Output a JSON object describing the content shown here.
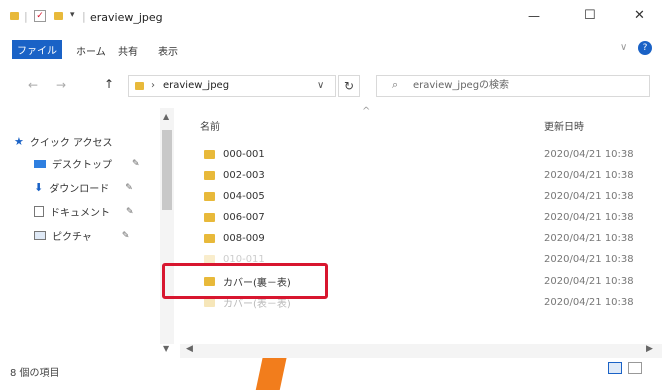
{
  "title_bar": {
    "title": "eraview_jpeg",
    "qat_sep": "|",
    "qat_dropdown": "▾"
  },
  "window_controls": {
    "minimize": "—",
    "maximize": "☐",
    "close": "✕"
  },
  "ribbon": {
    "file": "ファイル",
    "tabs": [
      "ホーム",
      "共有",
      "表示"
    ],
    "expand": "∨",
    "help": "?"
  },
  "address_bar": {
    "back": "←",
    "forward": "→",
    "up": "↑",
    "path_sep": "›",
    "path": "eraview_jpeg",
    "dropdown": "∨",
    "refresh": "↻"
  },
  "search": {
    "placeholder": "eraview_jpegの検索"
  },
  "sidebar": {
    "quick_access": "クイック アクセス",
    "items": [
      "デスクトップ",
      "ダウンロード",
      "ドキュメント",
      "ピクチャ"
    ]
  },
  "columns": {
    "name": "名前",
    "date": "更新日時",
    "sort_indicator": "^"
  },
  "files": [
    {
      "name": "000-001",
      "date": "2020/04/21 10:38"
    },
    {
      "name": "002-003",
      "date": "2020/04/21 10:38"
    },
    {
      "name": "004-005",
      "date": "2020/04/21 10:38"
    },
    {
      "name": "006-007",
      "date": "2020/04/21 10:38"
    },
    {
      "name": "008-009",
      "date": "2020/04/21 10:38"
    },
    {
      "name": "010-011",
      "date": "2020/04/21 10:38"
    },
    {
      "name": "カバー(裏－表)",
      "date": "2020/04/21 10:38"
    },
    {
      "name": "カバー(表－表)",
      "date": "2020/04/21 10:38"
    }
  ],
  "status": {
    "count": "8 個の項目"
  },
  "colors": {
    "accent": "#1a62c6",
    "folder": "#e8b93a",
    "highlight": "#d8162f",
    "arrow": "#f27d1c"
  }
}
